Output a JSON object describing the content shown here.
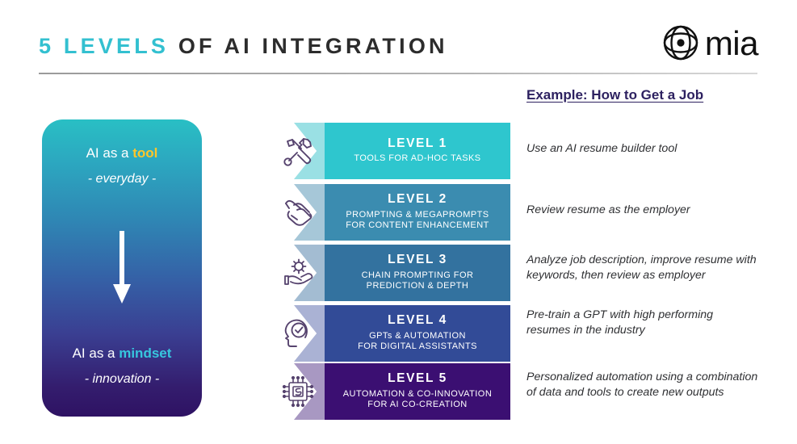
{
  "header": {
    "title_accent": "5 LEVELS",
    "title_plain": " OF AI INTEGRATION",
    "logo_word": "mia",
    "logo_mark_name": "mia-eye-logo-icon"
  },
  "example_column": {
    "heading": "Example: How to Get a Job"
  },
  "mindset_panel": {
    "top_prefix": "AI as a ",
    "top_highlight": "tool",
    "top_sub": "- everyday -",
    "bottom_prefix": "AI as a ",
    "bottom_highlight": "mindset",
    "bottom_sub": "- innovation -",
    "arrow_icon": "down-arrow-icon",
    "gradient_from": "#29bfc4",
    "gradient_to": "#2e1263",
    "highlight_top_color": "#ffc629",
    "highlight_bottom_color": "#37c6de"
  },
  "levels": [
    {
      "title": "LEVEL 1",
      "subtitle": "TOOLS FOR AD-HOC TASKS",
      "icon": "tools-wrench-screwdriver-icon",
      "color": "#2ec6ce",
      "tail_color": "#9ae0e4",
      "example": "Use an AI resume builder tool"
    },
    {
      "title": "LEVEL 2",
      "subtitle": "PROMPTING & MEGAPROMPTS\nFOR CONTENT ENHANCEMENT",
      "icon": "hand-writing-pen-icon",
      "color": "#3b8cb0",
      "tail_color": "#a6c7d8",
      "example": "Review resume as the employer"
    },
    {
      "title": "LEVEL 3",
      "subtitle": "CHAIN PROMPTING FOR\nPREDICTION & DEPTH",
      "icon": "hand-holding-gear-icon",
      "color": "#33729f",
      "tail_color": "#a3bcd2",
      "example": "Analyze job description, improve resume with\nkeywords, then review as employer"
    },
    {
      "title": "LEVEL 4",
      "subtitle": "GPTs & AUTOMATION\nFOR DIGITAL ASSISTANTS",
      "icon": "head-checkmark-icon",
      "color": "#324b97",
      "tail_color": "#aab2d4",
      "example": "Pre-train a GPT with high performing\nresumes in the industry"
    },
    {
      "title": "LEVEL 5",
      "subtitle": "AUTOMATION & CO-INNOVATION\nFOR AI CO-CREATION",
      "icon": "microchip-cpu-icon",
      "color": "#3b0f72",
      "tail_color": "#a898c2",
      "example": "Personalized automation using a combination\nof data and tools to create new outputs"
    }
  ]
}
